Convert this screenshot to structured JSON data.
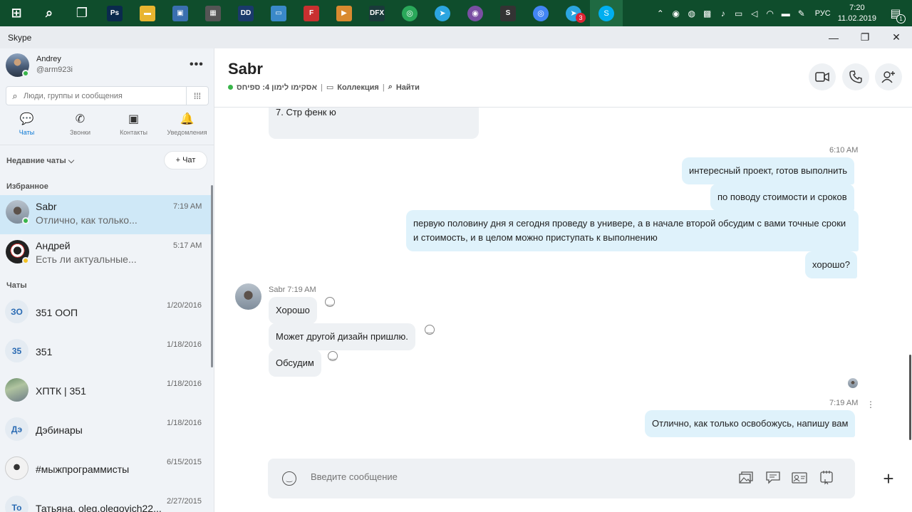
{
  "taskbar": {
    "apps": [
      {
        "name": "windows-start",
        "glyph": "⊞",
        "color": "#0f4d2c"
      },
      {
        "name": "search",
        "glyph": "⌕",
        "color": "#0f4d2c"
      },
      {
        "name": "task-view",
        "glyph": "❐",
        "color": "#0f4d2c"
      },
      {
        "name": "photoshop",
        "glyph": "Ps",
        "color": "#0a2a4d"
      },
      {
        "name": "file-explorer",
        "glyph": "▬",
        "color": "#e8b530"
      },
      {
        "name": "save-app",
        "glyph": "▣",
        "color": "#3a6fb0"
      },
      {
        "name": "calculator",
        "glyph": "▦",
        "color": "#555"
      },
      {
        "name": "app-dd",
        "glyph": "DD",
        "color": "#1a3a6b"
      },
      {
        "name": "app-rdp",
        "glyph": "▭",
        "color": "#3a89c9"
      },
      {
        "name": "app-red",
        "glyph": "F",
        "color": "#c93030"
      },
      {
        "name": "app-player",
        "glyph": "▶",
        "color": "#d98a30"
      },
      {
        "name": "app-dfx",
        "glyph": "DFX",
        "color": "#1a3a3a"
      },
      {
        "name": "app-green",
        "glyph": "◎",
        "color": "#2aa85a"
      },
      {
        "name": "app-telegram",
        "glyph": "➤",
        "color": "#2ca5e0"
      },
      {
        "name": "app-purple",
        "glyph": "◉",
        "color": "#7a4fa3"
      },
      {
        "name": "app-sublime",
        "glyph": "S",
        "color": "#333"
      },
      {
        "name": "app-chrome",
        "glyph": "◎",
        "color": "#4285f4"
      },
      {
        "name": "app-telegram2",
        "glyph": "➤",
        "color": "#2ca5e0",
        "badge": "3"
      },
      {
        "name": "app-skype",
        "glyph": "S",
        "color": "#00aff0",
        "active": true
      }
    ],
    "tray_lang": "РУС",
    "clock_time": "7:20",
    "clock_date": "11.02.2019",
    "notif_count": "1"
  },
  "window": {
    "title": "Skype"
  },
  "sidebar": {
    "profile_name": "Andrey",
    "profile_handle": "@arm923i",
    "search_placeholder": "Люди, группы и сообщения",
    "tabs": [
      {
        "label": "Чаты",
        "icon": "💬"
      },
      {
        "label": "Звонки",
        "icon": "✆"
      },
      {
        "label": "Контакты",
        "icon": "▣"
      },
      {
        "label": "Уведомления",
        "icon": "🔔"
      }
    ],
    "recent_label": "Недавние чаты ⌵",
    "new_chat_label": "+ Чат",
    "favorites_label": "Избранное",
    "chats_label": "Чаты",
    "favorites": [
      {
        "name": "Sabr",
        "preview": "Отлично, как только...",
        "time": "7:19 AM"
      },
      {
        "name": "Андрей",
        "preview": "Есть ли актуальные...",
        "time": "5:17 AM"
      }
    ],
    "chats": [
      {
        "name": "351 ООП",
        "date": "1/20/2016",
        "initials": "ЗО"
      },
      {
        "name": "351",
        "date": "1/18/2016",
        "initials": "35"
      },
      {
        "name": "ХПТК | 351",
        "date": "1/18/2016",
        "initials": ""
      },
      {
        "name": "Дэбинары",
        "date": "1/18/2016",
        "initials": "Дэ"
      },
      {
        "name": "#мыжпрограммисты",
        "date": "6/15/2015",
        "initials": ""
      },
      {
        "name": "Татьяна, oleg.olegovich22...",
        "date": "2/27/2015",
        "initials": "То"
      }
    ]
  },
  "conversation": {
    "name": "Sabr",
    "mood": "אסקימו לימון 4: ספיחס",
    "collection": "Коллекция",
    "find": "Найти",
    "messages": {
      "in_top": "7. Стр фенк ю",
      "out_time": "6:10 AM",
      "out1": "интересный проект, готов выполнить",
      "out2": "по поводу стоимости и сроков",
      "out3a": "первую половину дня я сегодня проведу в универе, а в начале второй обсудим с вами точные сроки",
      "out3b": "и стоимость, и в целом можно приступать к выполнению",
      "out4": "хорошо?",
      "in_header": "Sabr 7:19 AM",
      "in1": "Хорошо",
      "in2": "Может другой дизайн пришлю.",
      "in3": "Обсудим",
      "last_time": "7:19 AM",
      "last": "Отлично, как только освобожусь, напишу вам"
    },
    "composer_placeholder": "Введите сообщение"
  }
}
